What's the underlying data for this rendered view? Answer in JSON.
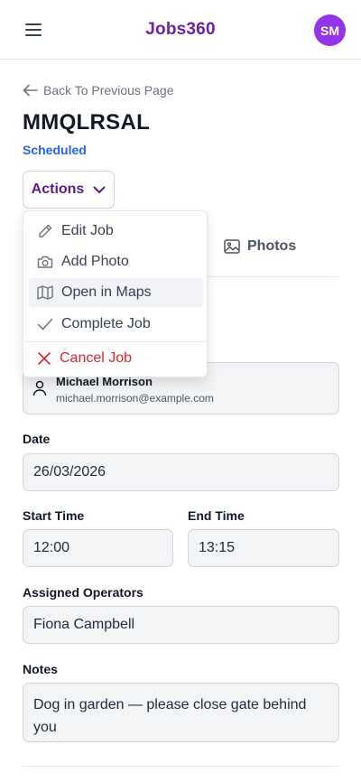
{
  "header": {
    "app_title": "Jobs360",
    "avatar_initials": "SM",
    "accent_color": "#6b21a8",
    "avatar_color": "#9333ea"
  },
  "nav": {
    "back_label": "Back To Previous Page"
  },
  "job": {
    "reference": "MMQLRSAL",
    "status": "Scheduled",
    "status_color": "#2563eb"
  },
  "actions": {
    "button_label": "Actions",
    "menu_items": [
      {
        "label": "Edit Job",
        "icon": "pencil-icon"
      },
      {
        "label": "Add Photo",
        "icon": "camera-icon"
      },
      {
        "label": "Open in Maps",
        "icon": "map-icon"
      },
      {
        "label": "Complete Job",
        "icon": "check-icon"
      },
      {
        "label": "Cancel Job",
        "icon": "x-icon",
        "color": "#dc2626"
      }
    ]
  },
  "tabs": {
    "photos_label": "Photos"
  },
  "customer": {
    "name": "Michael Morrison",
    "email": "michael.morrison@example.com"
  },
  "fields": {
    "date_label": "Date",
    "date_value": "26/03/2026",
    "start_time_label": "Start Time",
    "start_time_value": "12:00",
    "end_time_label": "End Time",
    "end_time_value": "13:15",
    "operators_label": "Assigned Operators",
    "operators_value": "Fiona Campbell",
    "notes_label": "Notes",
    "notes_value": "Dog in garden — please close gate behind you"
  }
}
